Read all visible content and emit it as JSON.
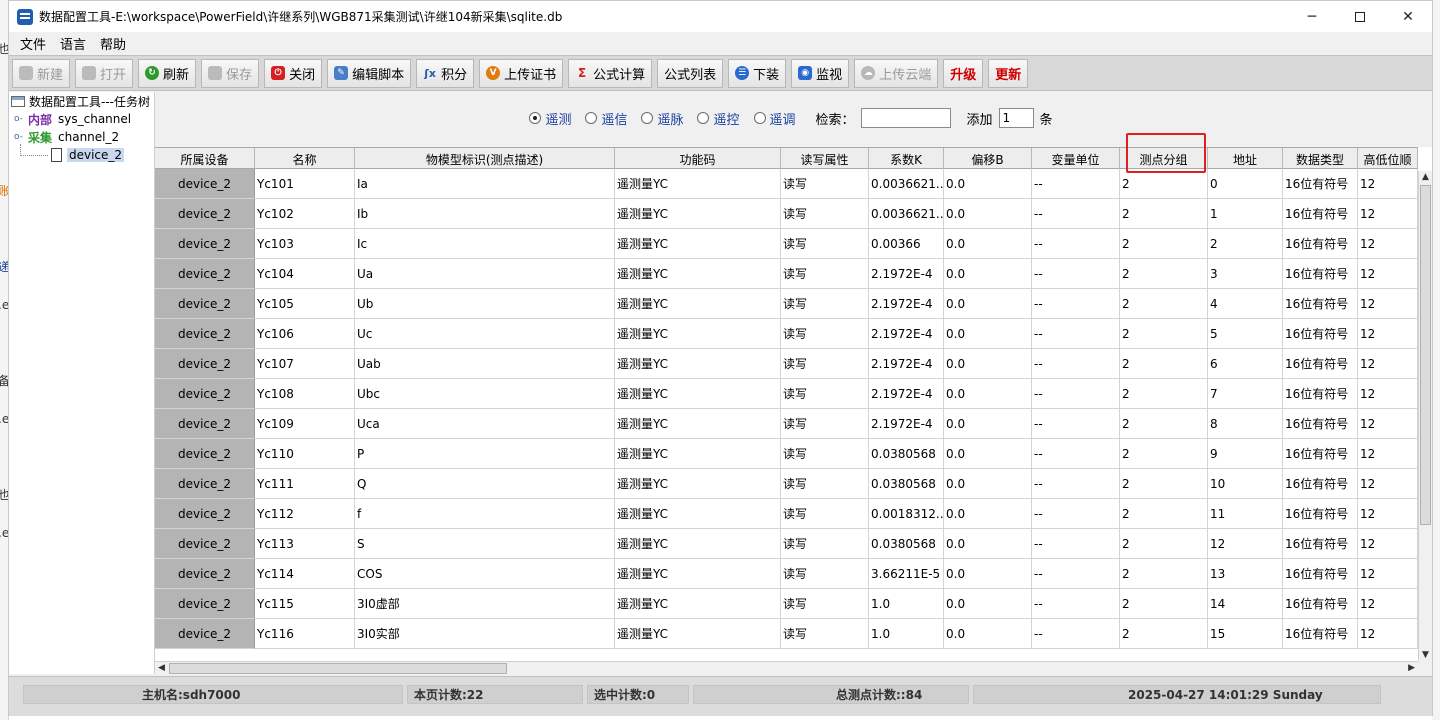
{
  "window": {
    "title": "数据配置工具-E:\\workspace\\PowerField\\许继系列\\WGB871采集测试\\许继104新采集\\sqlite.db"
  },
  "menu": [
    "文件",
    "语言",
    "帮助"
  ],
  "toolbar": [
    {
      "label": "新建",
      "icon": "new-icon",
      "disabled": true
    },
    {
      "label": "打开",
      "icon": "open-icon",
      "disabled": true
    },
    {
      "label": "刷新",
      "icon": "refresh-icon",
      "disabled": false
    },
    {
      "label": "保存",
      "icon": "save-icon",
      "disabled": true
    },
    {
      "label": "关闭",
      "icon": "close-icon",
      "disabled": false
    },
    {
      "label": "编辑脚本",
      "icon": "edit-script-icon",
      "disabled": false
    },
    {
      "label": "积分",
      "icon": "integral-icon",
      "disabled": false
    },
    {
      "label": "上传证书",
      "icon": "upload-cert-icon",
      "disabled": false
    },
    {
      "label": "公式计算",
      "icon": "formula-icon",
      "disabled": false
    },
    {
      "label": "公式列表",
      "icon": "",
      "disabled": false
    },
    {
      "label": "下装",
      "icon": "download-icon",
      "disabled": false
    },
    {
      "label": "监视",
      "icon": "monitor-icon",
      "disabled": false
    },
    {
      "label": "上传云端",
      "icon": "cloud-upload-icon",
      "disabled": true
    },
    {
      "label": "升级",
      "icon": "",
      "disabled": false
    },
    {
      "label": "更新",
      "icon": "",
      "disabled": false
    }
  ],
  "tree": {
    "root": "数据配置工具---任务树",
    "internal_label": "内部",
    "internal_channel": "sys_channel",
    "collect_label": "采集",
    "collect_channel": "channel_2",
    "device": "device_2"
  },
  "filter": {
    "options": [
      "遥测",
      "遥信",
      "遥脉",
      "遥控",
      "遥调"
    ],
    "selected": "遥测",
    "search_label": "检索：",
    "search_value": "",
    "add_label": "添加",
    "add_value": "1",
    "add_unit": "条"
  },
  "table": {
    "columns": [
      "所属设备",
      "名称",
      "物模型标识(测点描述)",
      "功能码",
      "读写属性",
      "系数K",
      "偏移B",
      "变量单位",
      "测点分组",
      "地址",
      "数据类型",
      "高低位顺"
    ],
    "rows": [
      [
        "device_2",
        "Yc101",
        "Ia",
        "遥测量YC",
        "读写",
        "0.0036621...",
        "0.0",
        "--",
        "2",
        "0",
        "16位有符号",
        "12"
      ],
      [
        "device_2",
        "Yc102",
        "Ib",
        "遥测量YC",
        "读写",
        "0.0036621...",
        "0.0",
        "--",
        "2",
        "1",
        "16位有符号",
        "12"
      ],
      [
        "device_2",
        "Yc103",
        "Ic",
        "遥测量YC",
        "读写",
        "0.00366",
        "0.0",
        "--",
        "2",
        "2",
        "16位有符号",
        "12"
      ],
      [
        "device_2",
        "Yc104",
        "Ua",
        "遥测量YC",
        "读写",
        "2.1972E-4",
        "0.0",
        "--",
        "2",
        "3",
        "16位有符号",
        "12"
      ],
      [
        "device_2",
        "Yc105",
        "Ub",
        "遥测量YC",
        "读写",
        "2.1972E-4",
        "0.0",
        "--",
        "2",
        "4",
        "16位有符号",
        "12"
      ],
      [
        "device_2",
        "Yc106",
        "Uc",
        "遥测量YC",
        "读写",
        "2.1972E-4",
        "0.0",
        "--",
        "2",
        "5",
        "16位有符号",
        "12"
      ],
      [
        "device_2",
        "Yc107",
        "Uab",
        "遥测量YC",
        "读写",
        "2.1972E-4",
        "0.0",
        "--",
        "2",
        "6",
        "16位有符号",
        "12"
      ],
      [
        "device_2",
        "Yc108",
        "Ubc",
        "遥测量YC",
        "读写",
        "2.1972E-4",
        "0.0",
        "--",
        "2",
        "7",
        "16位有符号",
        "12"
      ],
      [
        "device_2",
        "Yc109",
        "Uca",
        "遥测量YC",
        "读写",
        "2.1972E-4",
        "0.0",
        "--",
        "2",
        "8",
        "16位有符号",
        "12"
      ],
      [
        "device_2",
        "Yc110",
        "P",
        "遥测量YC",
        "读写",
        "0.0380568",
        "0.0",
        "--",
        "2",
        "9",
        "16位有符号",
        "12"
      ],
      [
        "device_2",
        "Yc111",
        "Q",
        "遥测量YC",
        "读写",
        "0.0380568",
        "0.0",
        "--",
        "2",
        "10",
        "16位有符号",
        "12"
      ],
      [
        "device_2",
        "Yc112",
        "f",
        "遥测量YC",
        "读写",
        "0.0018312...",
        "0.0",
        "--",
        "2",
        "11",
        "16位有符号",
        "12"
      ],
      [
        "device_2",
        "Yc113",
        "S",
        "遥测量YC",
        "读写",
        "0.0380568",
        "0.0",
        "--",
        "2",
        "12",
        "16位有符号",
        "12"
      ],
      [
        "device_2",
        "Yc114",
        "COS",
        "遥测量YC",
        "读写",
        "3.66211E-5",
        "0.0",
        "--",
        "2",
        "13",
        "16位有符号",
        "12"
      ],
      [
        "device_2",
        "Yc115",
        "3I0虚部",
        "遥测量YC",
        "读写",
        "1.0",
        "0.0",
        "--",
        "2",
        "14",
        "16位有符号",
        "12"
      ],
      [
        "device_2",
        "Yc116",
        "3I0实部",
        "遥测量YC",
        "读写",
        "1.0",
        "0.0",
        "--",
        "2",
        "15",
        "16位有符号",
        "12"
      ]
    ]
  },
  "status": {
    "host": "主机名:sdh7000",
    "page_count": "本页计数:22",
    "selected_count": "选中计数:0",
    "total_count": "总测点计数::84",
    "datetime": "2025-04-27 14:01:29 Sunday"
  },
  "colors": {
    "accent_red": "#d00000",
    "radio_blue": "#1b3f9f",
    "internal_purple": "#7b2fa8",
    "collect_green": "#2e9a2e",
    "highlight_red": "#e02020"
  }
}
